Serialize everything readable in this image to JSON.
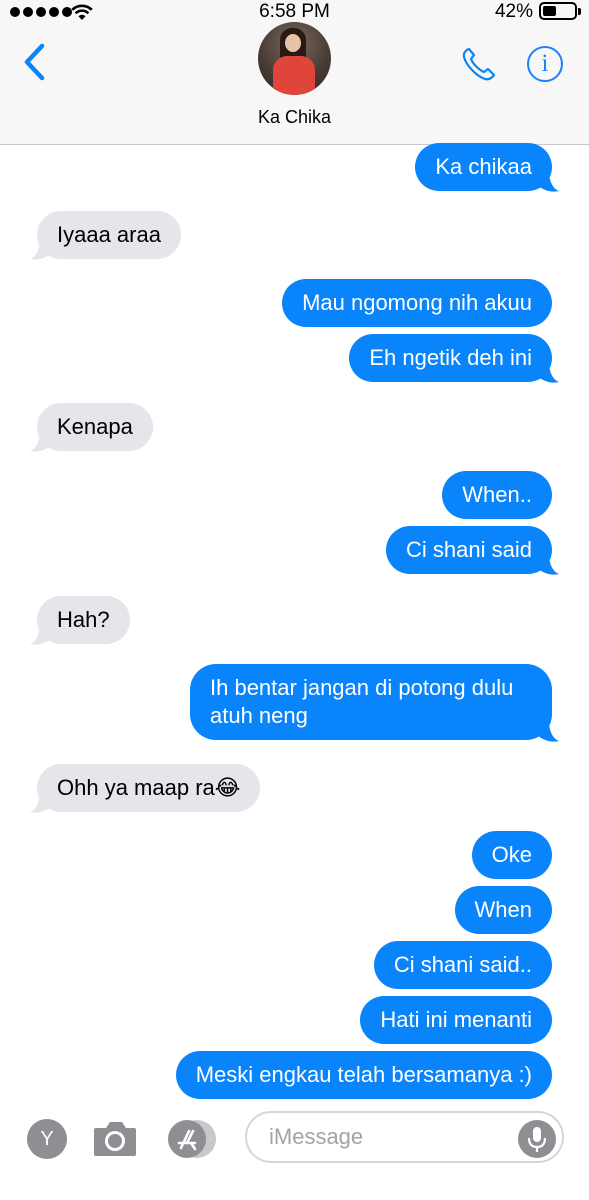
{
  "status_bar": {
    "time": "6:58 PM",
    "battery_percent": "42%",
    "battery_level": 0.42
  },
  "header": {
    "contact_name": "Ka Chika",
    "info_label": "i"
  },
  "messages": [
    {
      "from": "me",
      "text": "Ka chikaa"
    },
    {
      "from": "them",
      "text": "Iyaaa araa"
    },
    {
      "from": "me",
      "text": "Mau ngomong nih akuu"
    },
    {
      "from": "me",
      "text": "Eh ngetik deh ini"
    },
    {
      "from": "them",
      "text": "Kenapa"
    },
    {
      "from": "me",
      "text": "When.."
    },
    {
      "from": "me",
      "text": "Ci shani said"
    },
    {
      "from": "them",
      "text": "Hah?"
    },
    {
      "from": "me",
      "text": "Ih bentar jangan di potong dulu atuh neng"
    },
    {
      "from": "them",
      "text": "Ohh ya maap ra😂"
    },
    {
      "from": "me",
      "text": "Oke"
    },
    {
      "from": "me",
      "text": "When"
    },
    {
      "from": "me",
      "text": "Ci shani said.."
    },
    {
      "from": "me",
      "text": "Hati ini menanti"
    },
    {
      "from": "me",
      "text": "Meski engkau telah bersamanya :)"
    }
  ],
  "input_bar": {
    "apps_label": "Y",
    "placeholder": "iMessage"
  },
  "colors": {
    "accent": "#0a84fb",
    "incoming_bubble": "#e5e5ea",
    "icon_gray": "#8e8e93"
  },
  "icons": [
    "signal-icon",
    "wifi-icon",
    "battery-icon",
    "back-chevron-icon",
    "phone-icon",
    "info-icon",
    "camera-icon",
    "app-store-icon",
    "microphone-icon"
  ]
}
